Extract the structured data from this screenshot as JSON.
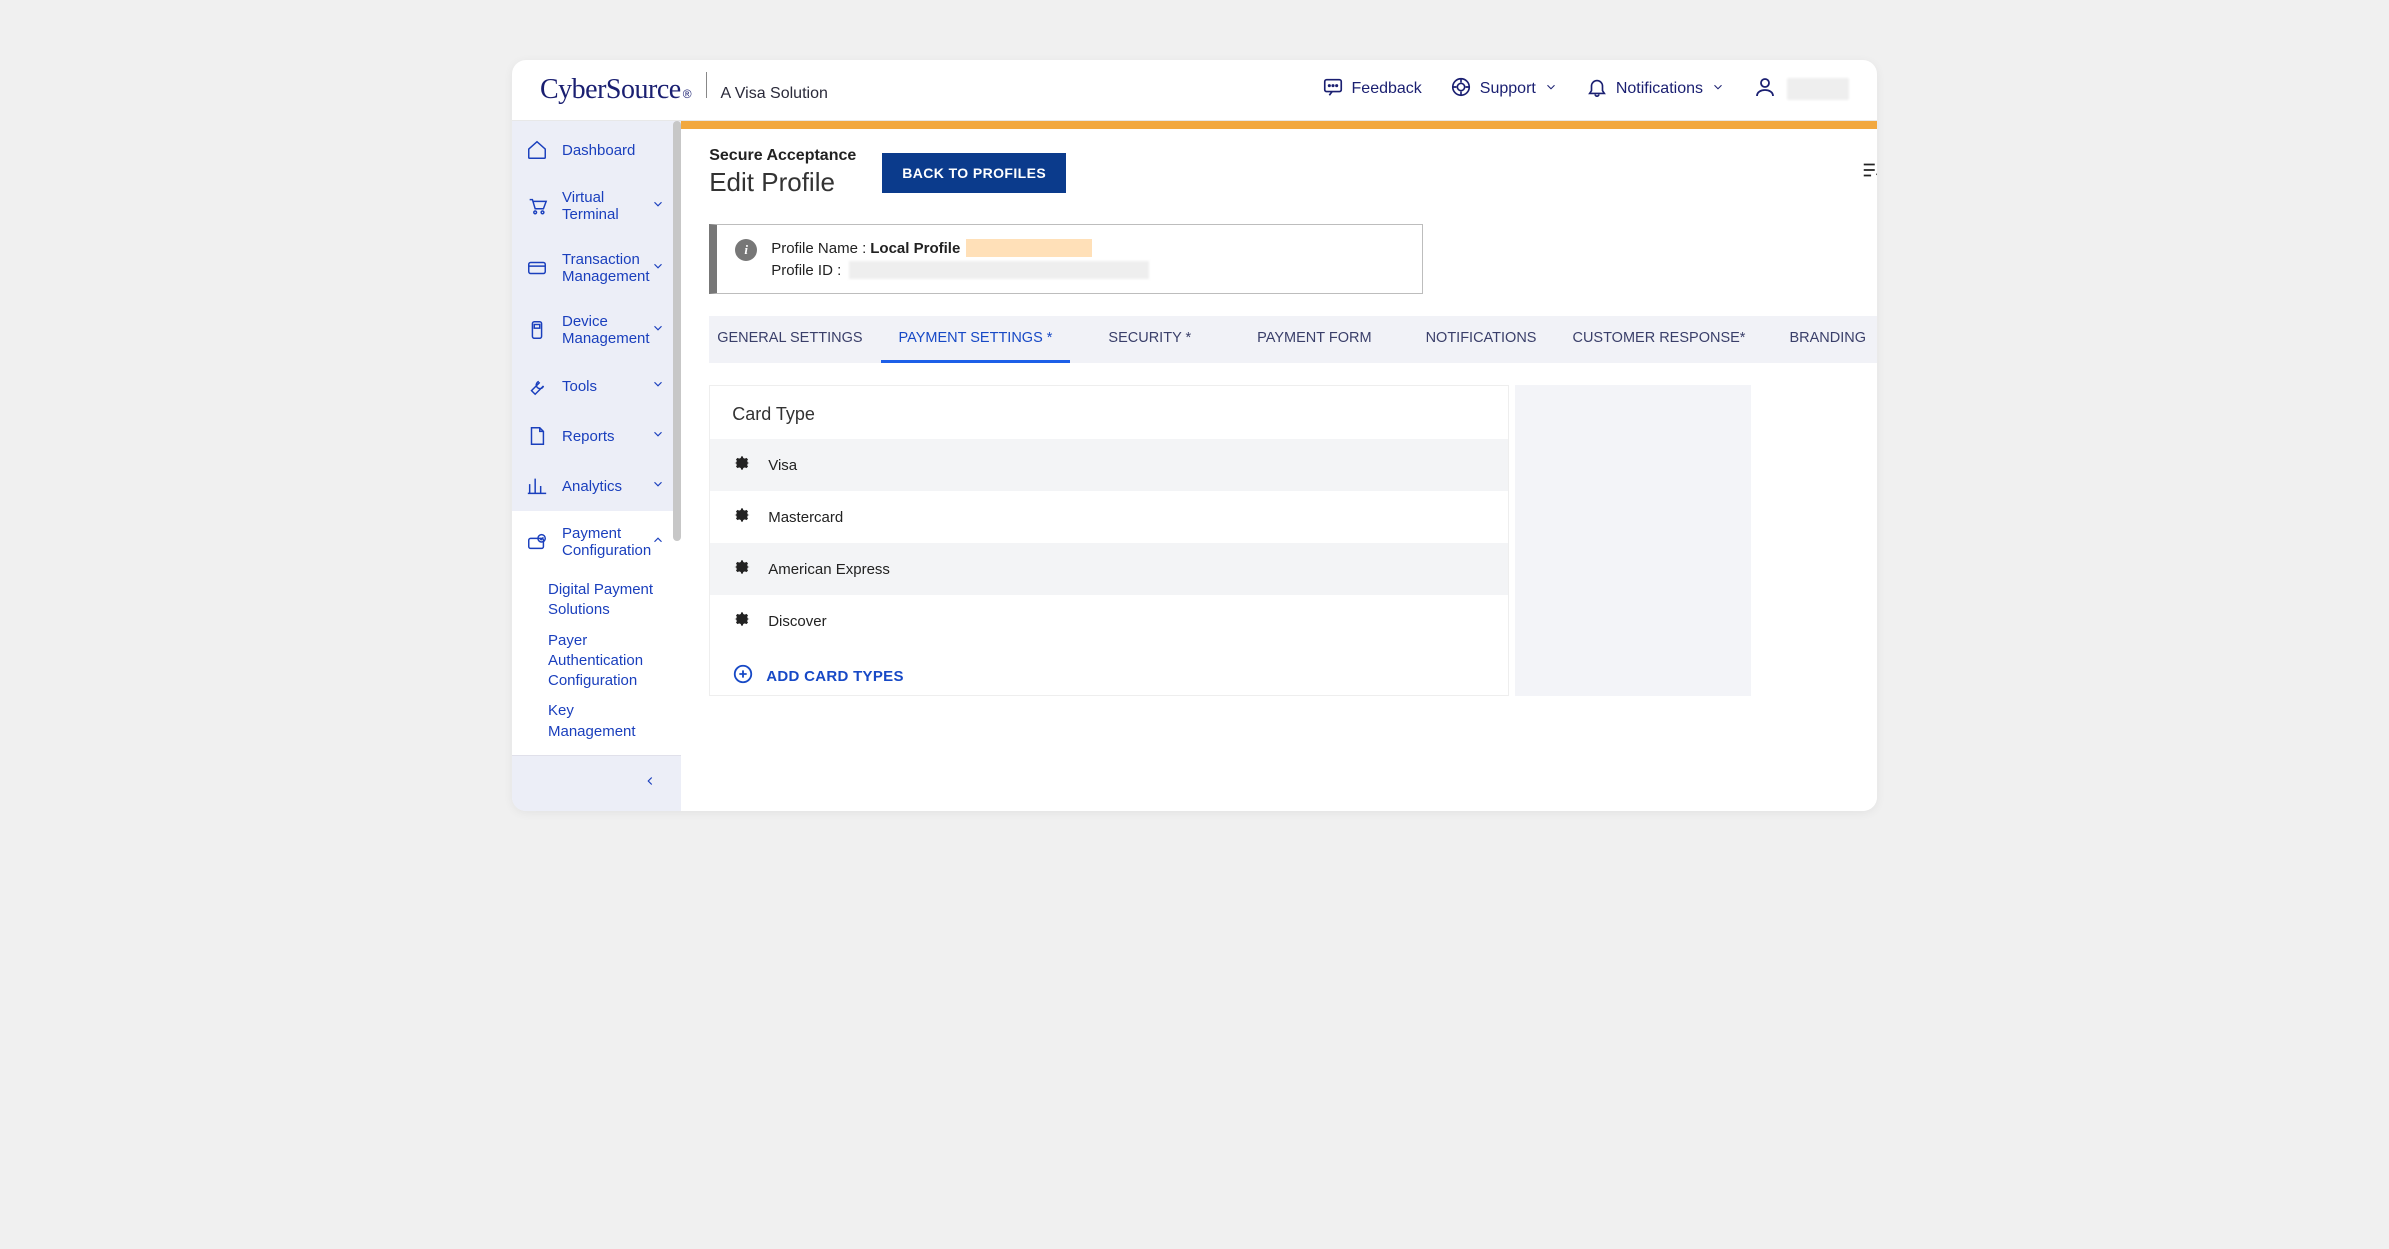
{
  "header": {
    "logo": "CyberSource",
    "tagline": "A Visa Solution",
    "feedback": "Feedback",
    "support": "Support",
    "notifications": "Notifications"
  },
  "sidebar": {
    "items": [
      {
        "label": "Dashboard"
      },
      {
        "label": "Virtual Terminal"
      },
      {
        "label": "Transaction Management"
      },
      {
        "label": "Device Management"
      },
      {
        "label": "Tools"
      },
      {
        "label": "Reports"
      },
      {
        "label": "Analytics"
      },
      {
        "label": "Payment Configuration"
      }
    ],
    "subitems": [
      "Digital Payment Solutions",
      "Payer Authentication Configuration",
      "Key Management"
    ]
  },
  "page": {
    "kicker": "Secure Acceptance",
    "title": "Edit Profile",
    "back_btn": "BACK TO PROFILES",
    "profile_name_label": "Profile Name :",
    "profile_name_value": "Local Profile",
    "profile_id_label": "Profile ID :"
  },
  "tabs": [
    "GENERAL SETTINGS",
    "PAYMENT SETTINGS *",
    "SECURITY *",
    "PAYMENT FORM",
    "NOTIFICATIONS",
    "CUSTOMER RESPONSE*",
    "BRANDING"
  ],
  "cardTypes": {
    "heading": "Card Type",
    "rows": [
      "Visa",
      "Mastercard",
      "American Express",
      "Discover"
    ],
    "add": "ADD CARD TYPES"
  }
}
